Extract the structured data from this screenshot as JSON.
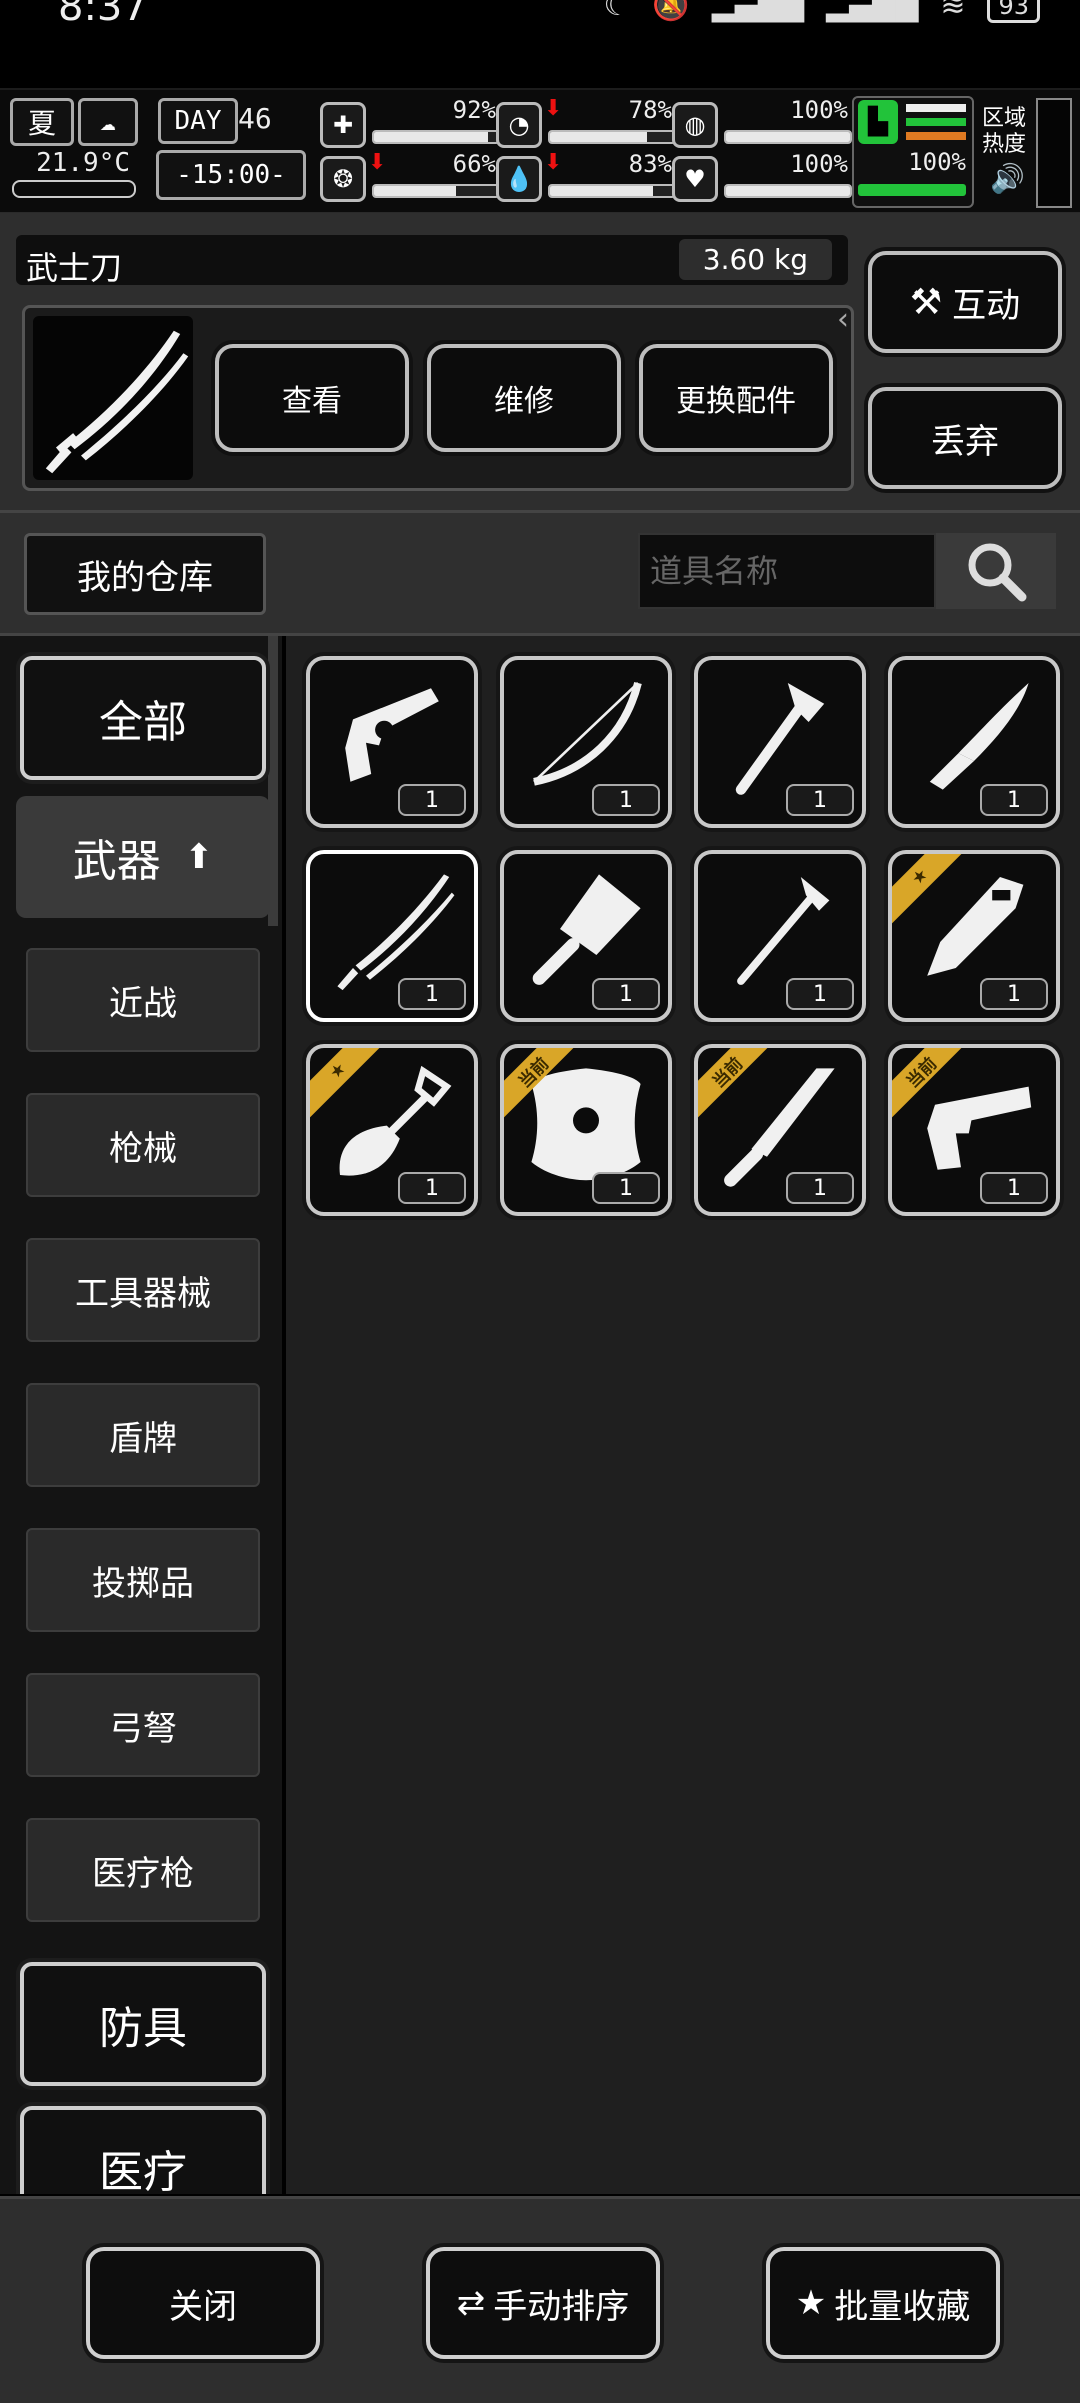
{
  "status_bar": {
    "time": "8:37",
    "battery": "93"
  },
  "hud": {
    "season": "夏",
    "temperature": "21.9°C",
    "day_label": "DAY",
    "day": "46",
    "time": "-15:00-",
    "stats": [
      {
        "name": "health-icon",
        "value": "92%",
        "fill": 0.92,
        "arrow": false
      },
      {
        "name": "stomach-icon",
        "value": "78%",
        "fill": 0.78,
        "arrow": true
      },
      {
        "name": "shield-stat-icon",
        "value": "100%",
        "fill": 1.0,
        "arrow": false
      },
      {
        "name": "brain-icon",
        "value": "66%",
        "fill": 0.66,
        "arrow": true
      },
      {
        "name": "water-icon",
        "value": "83%",
        "fill": 0.83,
        "arrow": true
      },
      {
        "name": "heart-icon",
        "value": "100%",
        "fill": 1.0,
        "arrow": false
      }
    ],
    "stamina": "100%",
    "area_heat_label": "区域热度"
  },
  "selected_item": {
    "name": "武士刀",
    "weight": "3.60 kg",
    "actions": {
      "view": "查看",
      "repair": "维修",
      "attach": "更换配件"
    },
    "interact": "互动",
    "discard": "丢弃"
  },
  "warehouse": {
    "title": "我的仓库",
    "search_placeholder": "道具名称"
  },
  "sidebar": {
    "all": "全部",
    "weapons": "武器",
    "sub": [
      "近战",
      "枪械",
      "工具器械",
      "盾牌",
      "投掷品",
      "弓弩",
      "医疗枪"
    ],
    "armor": "防具",
    "medical": "医疗"
  },
  "grid": {
    "items": [
      {
        "name": "revolver",
        "qty": "1",
        "ribbon": ""
      },
      {
        "name": "bow",
        "qty": "1",
        "ribbon": ""
      },
      {
        "name": "axe",
        "qty": "1",
        "ribbon": ""
      },
      {
        "name": "knife",
        "qty": "1",
        "ribbon": ""
      },
      {
        "name": "katana",
        "qty": "1",
        "ribbon": ""
      },
      {
        "name": "cleaver",
        "qty": "1",
        "ribbon": ""
      },
      {
        "name": "fire-axe",
        "qty": "1",
        "ribbon": ""
      },
      {
        "name": "machete-tool",
        "qty": "1",
        "ribbon": "★"
      },
      {
        "name": "shovel",
        "qty": "1",
        "ribbon": "★"
      },
      {
        "name": "shield",
        "qty": "1",
        "ribbon": "当前"
      },
      {
        "name": "machete",
        "qty": "1",
        "ribbon": "当前"
      },
      {
        "name": "pistol",
        "qty": "1",
        "ribbon": "当前"
      }
    ]
  },
  "bottom": {
    "close": "关闭",
    "sort": "手动排序",
    "favorite": "批量收藏"
  },
  "colors": {
    "ribbon": "#d9a628",
    "stamina_green": "#22c33a",
    "warning_red": "#e11111"
  }
}
